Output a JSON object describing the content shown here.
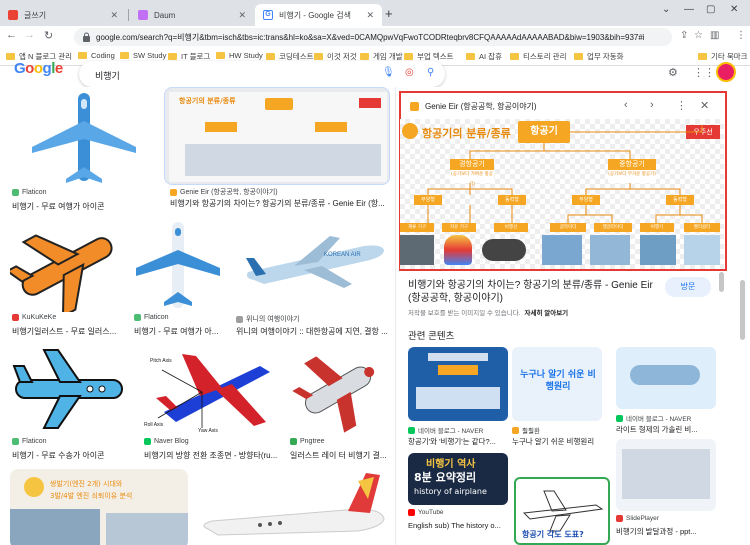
{
  "browser": {
    "tabs": [
      {
        "label": "글쓰기",
        "color": "#ea4335"
      },
      {
        "label": "Daum",
        "color": "#c26ff5"
      },
      {
        "label": "비행기 - Google 검색",
        "color": "#4285f4"
      }
    ],
    "url": "google.com/search?q=비행기&tbm=isch&tbs=ic:trans&hl=ko&sa=X&ved=0CAMQpwVqFwoTCODRteqbrv8CFQAAAAAdAAAAABAD&biw=1903&bih=937#imgrc=iMcAj..."
  },
  "bookmarks": [
    "앱 N 블로그 관리",
    "Coding",
    "SW Study",
    "IT 블로그",
    "HW Study",
    "코딩테스트",
    "이것 저것",
    "게임 개발",
    "부업 텍스트",
    "AI 잡휴",
    "티스토리 관리",
    "업무 자동화"
  ],
  "bookmarks_overflow": "기타 북마크",
  "google": {
    "logo": [
      "G",
      "o",
      "o",
      "g",
      "l",
      "e"
    ],
    "logo_colors": [
      "#4285f4",
      "#ea4335",
      "#fbbc05",
      "#4285f4",
      "#34a853",
      "#ea4335"
    ],
    "query": "비행기"
  },
  "results": [
    {
      "source": "Flaticon",
      "title": "비행기 - 무료 여행가 아이콘",
      "fav": "#4dbd74"
    },
    {
      "source": "Genie Eir (항공공학, 항공이야기)",
      "title": "비행기와 항공기의 차이는? 항공기의 분류/종류 - Genie Eir (항...",
      "fav": "#f5a623"
    },
    {
      "source": "KuKuKeKe",
      "title": "비행기일러스트 - 무료 일러스...",
      "fav": "#e53935"
    },
    {
      "source": "Flaticon",
      "title": "비행기 - 무료 여행가 아...",
      "fav": "#4dbd74"
    },
    {
      "source": "위니의 여행이야기",
      "title": "위니의 여행이야기 :: 대한항공에 지연, 결항 ...",
      "fav": "#9e9e9e"
    },
    {
      "source": "Flaticon",
      "title": "비행기 - 무료 수송가 아이콘",
      "fav": "#4dbd74"
    },
    {
      "source": "Naver Blog",
      "title": "비행기의 방향 전환 조종면 - 방향타(ru...",
      "fav": "#03c75a"
    },
    {
      "source": "Pngtree",
      "title": "일러스트 레이 터 비행기 결...",
      "fav": "#34a853"
    }
  ],
  "diagram_labels": {
    "pitch": "Pitch Axis",
    "roll": "Roll Axis",
    "yaw": "Yaw Axis"
  },
  "panel": {
    "source": "Genie Eir (항공공학, 항공이야기)",
    "title": "비행기와 항공기의 차이는? 항공기의 분류/종류 - Genie Eir (항공공학, 항공이야기)",
    "visit": "방문",
    "notice": "저작물 보호를 받는 이미지일 수 있습니다.",
    "notice_link": "자세히 알아보기",
    "related_title": "관련 콘텐츠",
    "img_title": "항공기의 분류/종류",
    "root": "항공기",
    "space": "우주선",
    "lighter": "경항공기",
    "heavier": "중항공기",
    "lighter_sub": "(공기보다 가벼운 항공기)",
    "heavier_sub": "(공기보다 무거운 항공기)",
    "n1": "부양형",
    "n2": "동력형",
    "n3": "부양형",
    "n4": "동력형",
    "l1": "계류 기구",
    "l2": "자유 기구",
    "l3": "비행선",
    "l4": "글라이더",
    "l5": "행글라이더",
    "l6": "비행기",
    "l7": "헬리콥터"
  },
  "related": [
    {
      "source": "네이버 블로그 - NAVER",
      "title": "항공기'와 '비행기'는 같다?...",
      "fav": "#03c75a"
    },
    {
      "source": "훨훨환",
      "title": "누구나 알기 쉬운 비행원리",
      "fav": "#f5a623",
      "overlay": "누구나 알기 쉬운 비행원리"
    },
    {
      "source": "네이버 블로그 - NAVER",
      "title": "라이트 형제의 가솔린 비...",
      "fav": "#03c75a"
    },
    {
      "source": "YouTube",
      "title": "English sub) The history o...",
      "fav": "#ff0000",
      "overlay1": "비행기 역사",
      "overlay2": "8분 요약정리",
      "overlay3": "history of airplane"
    },
    {
      "source": "SlidePlayer",
      "title": "비행기의 발달과정 - ppt...",
      "fav": "#e53935"
    }
  ],
  "bottom_thumb": {
    "line1": "쌍발기(엔진 2개) 시대와",
    "line2": "3발/4발 엔진 쇠퇴이유 분석"
  },
  "related_overlay_bottom": "항공기 각도 도표?"
}
